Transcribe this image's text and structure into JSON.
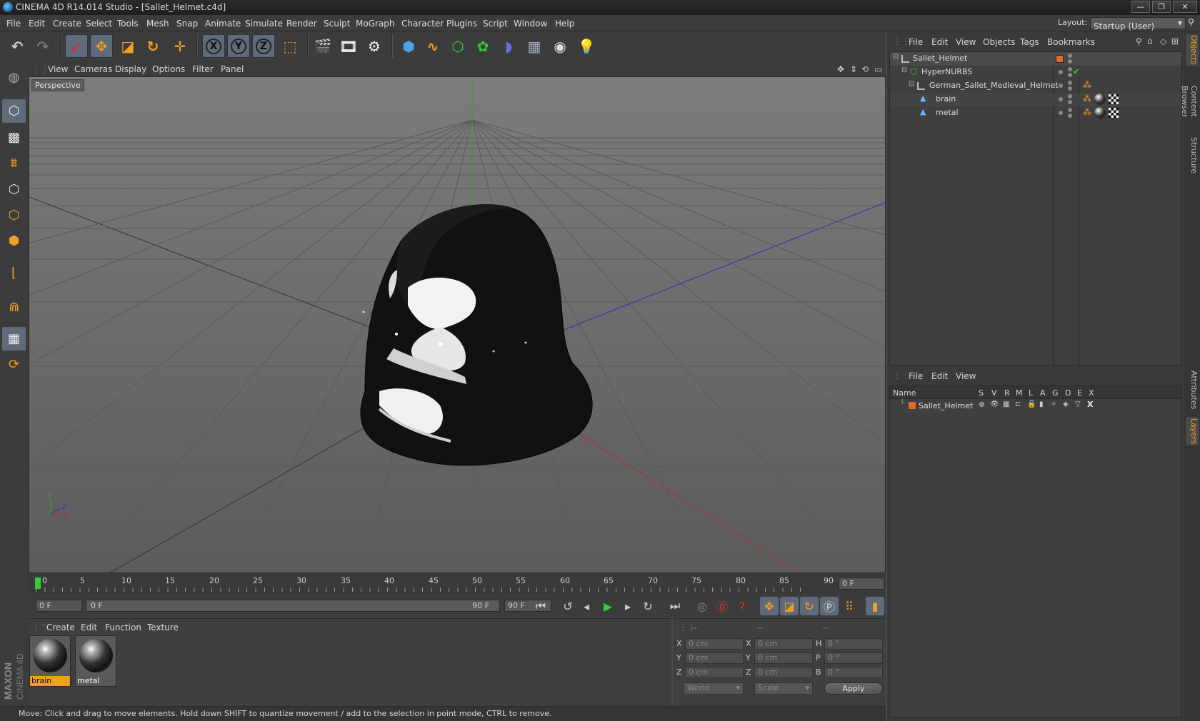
{
  "window": {
    "title": "CINEMA 4D R14.014 Studio - [Sallet_Helmet.c4d]",
    "minimize": "—",
    "maximize": "❐",
    "close": "✕"
  },
  "menu": [
    "File",
    "Edit",
    "Create",
    "Select",
    "Tools",
    "Mesh",
    "Snap",
    "Animate",
    "Simulate",
    "Render",
    "Sculpt",
    "MoGraph",
    "Character",
    "Plugins",
    "Script",
    "Window",
    "Help"
  ],
  "layout": {
    "label": "Layout:",
    "value": "Startup (User)"
  },
  "toolbar": {
    "x_axis": "X",
    "y_axis": "Y",
    "z_axis": "Z"
  },
  "viewport": {
    "menu": [
      "View",
      "Cameras",
      "Display",
      "Options",
      "Filter",
      "Panel"
    ],
    "camera_label": "Perspective",
    "axis_x": "X",
    "axis_y": "Y",
    "axis_z": "Z"
  },
  "timeline": {
    "ticks": [
      "0",
      "5",
      "10",
      "15",
      "20",
      "25",
      "30",
      "35",
      "40",
      "45",
      "50",
      "55",
      "60",
      "65",
      "70",
      "75",
      "80",
      "85",
      "90"
    ],
    "current_frame": "0 F",
    "start_field": "0 F",
    "range_start": "0 F",
    "range_end": "90 F",
    "end_field": "90 F"
  },
  "materials": {
    "menu": [
      "Create",
      "Edit",
      "Function",
      "Texture"
    ],
    "items": [
      {
        "label": "brain",
        "selected": true
      },
      {
        "label": "metal",
        "selected": false
      }
    ]
  },
  "coordinates": {
    "header": [
      "--",
      "--",
      "--"
    ],
    "rows": [
      {
        "a": "X",
        "av": "0 cm",
        "b": "X",
        "bv": "0 cm",
        "c": "H",
        "cv": "0 °"
      },
      {
        "a": "Y",
        "av": "0 cm",
        "b": "Y",
        "bv": "0 cm",
        "c": "P",
        "cv": "0 °"
      },
      {
        "a": "Z",
        "av": "0 cm",
        "b": "Z",
        "bv": "0 cm",
        "c": "B",
        "cv": "0 °"
      }
    ],
    "mode": "World",
    "transform": "Scale",
    "apply": "Apply"
  },
  "status": "Move: Click and drag to move elements. Hold down SHIFT to quantize movement / add to the selection in point mode, CTRL to remove.",
  "brand": {
    "line1": "MAXON",
    "line2": "CINEMA 4D"
  },
  "objects_panel": {
    "menu": [
      "File",
      "Edit",
      "View",
      "Objects",
      "Tags",
      "Bookmarks"
    ],
    "items": [
      {
        "name": "Sallet_Helmet"
      },
      {
        "name": "HyperNURBS"
      },
      {
        "name": "German_Sallet_Medieval_Helmet"
      },
      {
        "name": "brain"
      },
      {
        "name": "metal"
      }
    ],
    "check": "✔"
  },
  "layers_panel": {
    "menu": [
      "File",
      "Edit",
      "View"
    ],
    "columns": [
      "Name",
      "S",
      "V",
      "R",
      "M",
      "L",
      "A",
      "G",
      "D",
      "E",
      "X"
    ],
    "rows": [
      {
        "name": "Sallet_Helmet",
        "color": "#e06a2a"
      }
    ]
  },
  "side_tabs": [
    "Objects",
    "Content Browser",
    "Structure",
    "Attributes",
    "Layers"
  ],
  "colors": {
    "accent": "#f0a020",
    "sel_blue": "#5f6b7a",
    "layer_orange": "#e06a2a"
  }
}
